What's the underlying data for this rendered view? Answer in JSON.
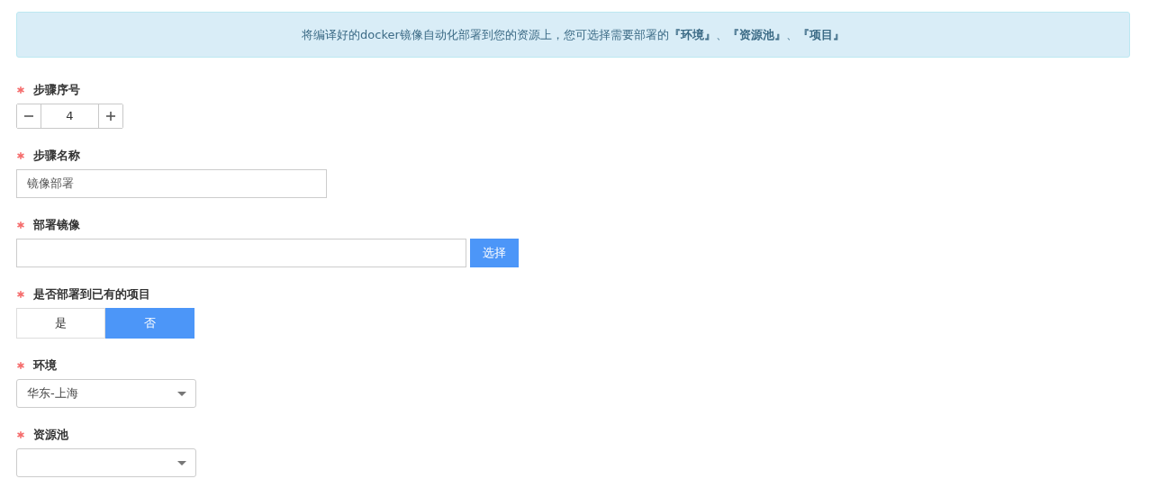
{
  "notice": "将编译好的docker镜像自动化部署到您的资源上，您可选择需要部署的**『环境』**、**『资源池』**、**『项目』**",
  "fields": [
    {
      "kind": "stepper",
      "label": "步骤序号",
      "required": true,
      "value": "4"
    },
    {
      "kind": "text",
      "label": "步骤名称",
      "required": true,
      "value": "镜像部署"
    },
    {
      "kind": "picker",
      "label": "部署镜像",
      "required": true,
      "button": "选择"
    },
    {
      "kind": "toggle",
      "label": "是否部署到已有的项目",
      "required": true,
      "options": [
        {
          "label": "是",
          "selected": false
        },
        {
          "label": "否",
          "selected": true
        }
      ]
    },
    {
      "kind": "select",
      "label": "环境",
      "required": true,
      "value": "华东-上海"
    },
    {
      "kind": "select",
      "label": "资源池",
      "required": true
    }
  ]
}
